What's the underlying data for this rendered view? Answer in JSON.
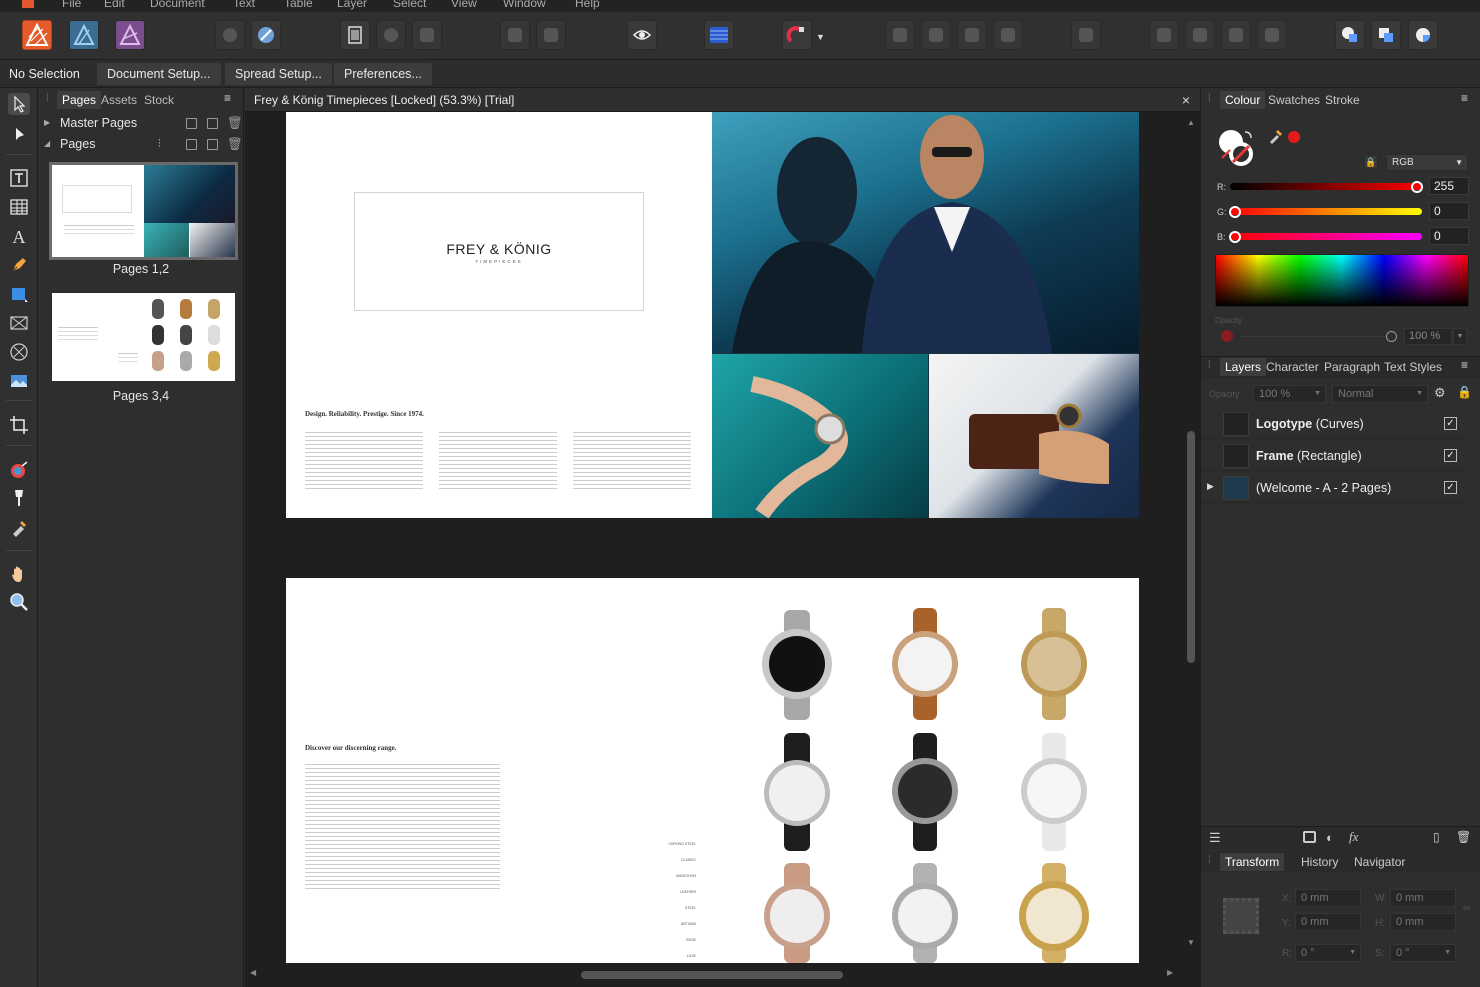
{
  "menu": [
    "File",
    "Edit",
    "Document",
    "Text",
    "Table",
    "Layer",
    "Select",
    "View",
    "Window",
    "Help"
  ],
  "context_bar": {
    "status": "No Selection",
    "buttons": [
      "Document Setup...",
      "Spread Setup...",
      "Preferences..."
    ]
  },
  "pages_panel": {
    "tabs": [
      "Pages",
      "Assets",
      "Stock"
    ],
    "master_pages_label": "Master Pages",
    "pages_label": "Pages",
    "thumbnails": [
      {
        "label": "Pages 1,2"
      },
      {
        "label": "Pages 3,4"
      }
    ]
  },
  "document": {
    "tab_title": "Frey & König Timepieces [Locked] (53.3%) [Trial]",
    "close": "×",
    "spread1": {
      "logo_text": "FREY & KÖNIG",
      "logo_sub": "TIMEPIECES",
      "heading": "Design. Reliability. Prestige. Since 1974."
    },
    "spread2": {
      "heading": "Discover our discerning range.",
      "watch_names": [
        "CHRONO STEEL",
        "CLASSIC",
        "MARATHON",
        "LEATHER",
        "STEEL",
        "ARTISAN",
        "ROSE",
        "LUXE"
      ]
    }
  },
  "colour_panel": {
    "tabs": [
      "Colour",
      "Swatches",
      "Stroke"
    ],
    "model": "RGB",
    "r_label": "R:",
    "r_value": "255",
    "g_label": "G:",
    "g_value": "0",
    "b_label": "B:",
    "b_value": "0",
    "opacity_label": "Opacity",
    "opacity_value": "100 %",
    "swatch_color": "#e31b1b"
  },
  "layers_panel": {
    "tabs": [
      "Layers",
      "Character",
      "Paragraph",
      "Text Styles"
    ],
    "opacity_label": "Opacity",
    "opacity_value": "100 %",
    "blend_mode": "Normal",
    "layers": [
      {
        "name": "Logotype",
        "type": "(Curves)",
        "checked": "✓"
      },
      {
        "name": "Frame",
        "type": "(Rectangle)",
        "checked": "✓"
      },
      {
        "name": "(Welcome - A - 2 Pages)",
        "type": "",
        "checked": "✓"
      }
    ]
  },
  "transform_panel": {
    "tabs": [
      "Transform",
      "History",
      "Navigator"
    ],
    "x_label": "X:",
    "x_value": "0 mm",
    "y_label": "Y:",
    "y_value": "0 mm",
    "w_label": "W:",
    "w_value": "0 mm",
    "h_label": "H:",
    "h_value": "0 mm",
    "r_label": "R:",
    "r_value": "0 °",
    "s_label": "S:",
    "s_value": "0 °"
  }
}
